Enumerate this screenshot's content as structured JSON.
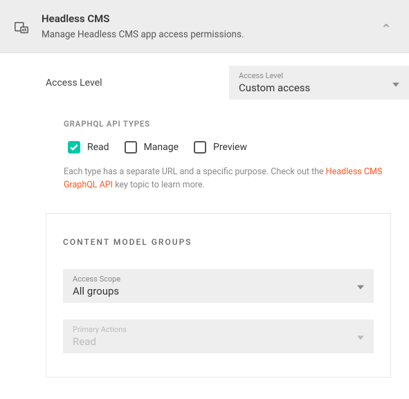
{
  "header": {
    "title": "Headless CMS",
    "subtitle": "Manage Headless CMS app access permissions."
  },
  "accessLevel": {
    "label": "Access Level",
    "selectLabel": "Access Level",
    "selectValue": "Custom access"
  },
  "apiTypes": {
    "heading": "GRAPHQL API TYPES",
    "items": [
      {
        "label": "Read",
        "checked": true
      },
      {
        "label": "Manage",
        "checked": false
      },
      {
        "label": "Preview",
        "checked": false
      }
    ],
    "helpPrefix": "Each type has a separate URL and a specific purpose. Check out the ",
    "helpLink": "Headless CMS GraphQL API",
    "helpSuffix": " key topic to learn more."
  },
  "contentModelGroups": {
    "heading": "CONTENT MODEL GROUPS",
    "accessScope": {
      "label": "Access Scope",
      "value": "All groups"
    },
    "primaryActions": {
      "label": "Primary Actions",
      "value": "Read"
    }
  }
}
